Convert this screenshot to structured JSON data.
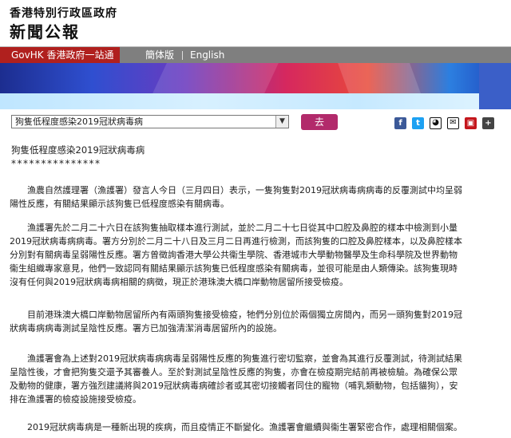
{
  "header": {
    "government_name": "香港特別行政區政府",
    "section_name": "新聞公報"
  },
  "topbar": {
    "portal_label": "GovHK 香港政府一站通",
    "lang_simplified": "簡体版",
    "lang_english": "English"
  },
  "article_selector": {
    "selected_value": "狗隻低程度感染2019冠狀病毒病",
    "go_label": "去"
  },
  "share_icons": [
    "facebook-icon",
    "twitter-icon",
    "weibo-icon",
    "email-icon",
    "print-icon",
    "bookmark-icon"
  ],
  "article": {
    "title": "狗隻低程度感染2019冠狀病毒病",
    "stars": "***************",
    "paragraphs": [
      {
        "lines": [
          "　　漁農自然護理署（漁護署）發言人今日（三月四日）表示，一隻狗隻對2019冠狀病毒病病毒的反覆測試中均呈弱",
          "陽性反應，有關結果顯示該狗隻已低程度感染有關病毒。"
        ]
      },
      {
        "lines": [
          "　　漁護署先於二月二十六日在該狗隻抽取樣本進行測試，並於二月二十七日從其中口腔及鼻腔的樣本中檢測到小量",
          "2019冠狀病毒病病毒。署方分別於二月二十八日及三月二日再進行檢測，而該狗隻的口腔及鼻腔樣本，以及鼻腔樣本",
          "分別對有關病毒呈弱陽性反應。署方曾徵詢香港大學公共衞生學院、香港城市大學動物醫學及生命科學院及世界動物",
          "衞生組織專家意見，他們一致認同有關結果顯示該狗隻已低程度感染有關病毒，並很可能是由人類傳染。該狗隻現時",
          "沒有任何與2019冠狀病毒病相關的病徵，現正於港珠澳大橋口岸動物居留所接受檢疫。"
        ]
      },
      {
        "lines": [
          "　　目前港珠澳大橋口岸動物居留所內有兩頭狗隻接受檢疫，牠們分別位於兩個獨立房間內，而另一頭狗隻對2019冠",
          "狀病毒病病毒測試呈陰性反應。署方已加強清潔消毒居留所內的設施。"
        ]
      },
      {
        "lines": [
          "　　漁護署會為上述對2019冠狀病毒病病毒呈弱陽性反應的狗隻進行密切監察，並會為其進行反覆測試，待測試結果",
          "呈陰性後，才會把狗隻交還予其審養人。至於對測試呈陰性反應的狗隻，亦會在檢疫期完結前再被檢驗。為確保公眾",
          "及動物的健康，署方強烈建議將與2019冠狀病毒病確診者或其密切接觸者同住的寵物（哺乳類動物，包括貓狗），安",
          "排在漁護署的檢疫設施接受檢疫。"
        ]
      },
      {
        "lines": [
          "　　2019冠狀病毒病是一種新出現的疾病，而且疫情正不斷變化。漁護署會繼續與衞生署緊密合作，處理相關個案。"
        ]
      }
    ]
  },
  "colors": {
    "portal_red": "#b0201e",
    "topbar_gray": "#7f7f7f",
    "go_button": "#b22a6b"
  }
}
